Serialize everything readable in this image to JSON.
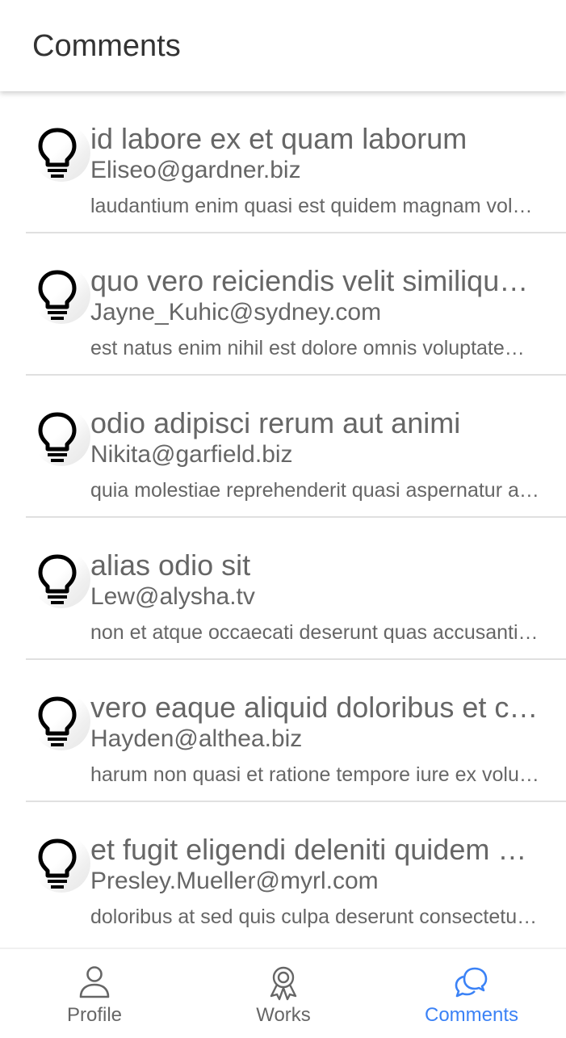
{
  "header": {
    "title": "Comments"
  },
  "comments": [
    {
      "title": "id labore ex et quam laborum",
      "email": "Eliseo@gardner.biz",
      "body": "laudantium enim quasi est quidem magnam voluptate ipsam eos tempora quo necessitatibus",
      "icon": "lightbulb-icon"
    },
    {
      "title": "quo vero reiciendis velit similique earum",
      "email": "Jayne_Kuhic@sydney.com",
      "body": "est natus enim nihil est dolore omnis voluptatem numquam et omnis occaecati quod ullam at",
      "icon": "lightbulb-icon"
    },
    {
      "title": "odio adipisci rerum aut animi",
      "email": "Nikita@garfield.biz",
      "body": "quia molestiae reprehenderit quasi aspernatur aut expedita occaecati aliquam eveniet laudantium",
      "icon": "lightbulb-icon"
    },
    {
      "title": "alias odio sit",
      "email": "Lew@alysha.tv",
      "body": "non et atque occaecati deserunt quas accusantium unde odit nobis qui voluptatem",
      "icon": "lightbulb-icon"
    },
    {
      "title": "vero eaque aliquid doloribus et culpa",
      "email": "Hayden@althea.biz",
      "body": "harum non quasi et ratione tempore iure ex voluptates in ratione harum architecto fugit inventore cupiditate",
      "icon": "lightbulb-icon"
    },
    {
      "title": "et fugit eligendi deleniti quidem qui sint nihil autem",
      "email": "Presley.Mueller@myrl.com",
      "body": "doloribus at sed quis culpa deserunt consectetur qui praesentium accusamus fugiat dicta",
      "icon": "lightbulb-icon"
    }
  ],
  "tabs": [
    {
      "label": "Profile",
      "icon": "person-icon",
      "active": false
    },
    {
      "label": "Works",
      "icon": "award-ribbon-icon",
      "active": false
    },
    {
      "label": "Comments",
      "icon": "chat-bubbles-icon",
      "active": true
    }
  ],
  "colors": {
    "accent": "#3b82f6",
    "text": "#666666",
    "title": "#333333",
    "divider": "#e0e0e0"
  }
}
